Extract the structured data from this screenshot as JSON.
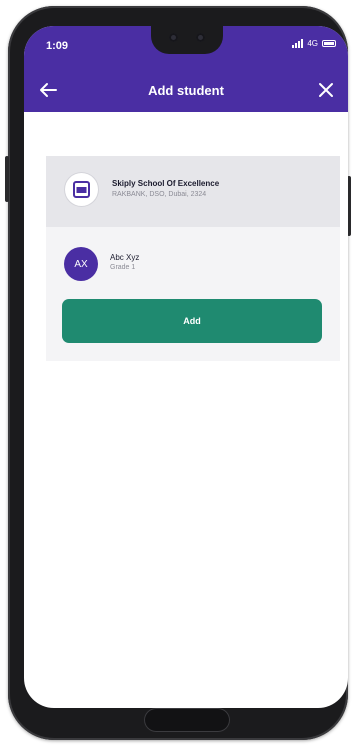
{
  "status_bar": {
    "time": "1:09",
    "network": "4G"
  },
  "header": {
    "title": "Add student",
    "back_icon": "arrow-left-icon",
    "close_icon": "close-icon",
    "background_color": "#4a2ea3"
  },
  "school": {
    "name": "Skiply School Of Excellence",
    "address": "RAKBANK, DSO, Dubai, 2324",
    "logo_icon": "school-logo-icon"
  },
  "student": {
    "initials": "AX",
    "name": "Abc Xyz",
    "grade": "Grade 1",
    "avatar_color": "#4a2ea3"
  },
  "actions": {
    "add_label": "Add",
    "add_color": "#1f8a70"
  }
}
